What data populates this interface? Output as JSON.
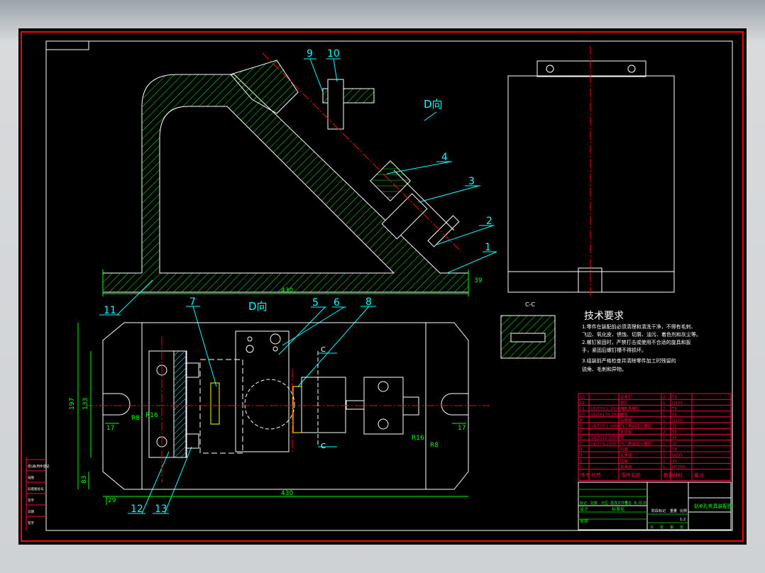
{
  "drawing": {
    "view_labels": {
      "side": "D向",
      "top": "D向",
      "section": "C-C",
      "section_arrow_top": "C",
      "section_arrow_bottom": "C"
    },
    "balloons": [
      "1",
      "2",
      "3",
      "4",
      "5",
      "6",
      "7",
      "8",
      "9",
      "10",
      "11",
      "12",
      "13"
    ],
    "dimensions": {
      "side_length": "430",
      "side_height": "39",
      "top_length": "430",
      "top_width": "197",
      "top_inner": "133",
      "slot_offset_left": "17",
      "slot_offset_right": "17",
      "radius_small": "R8",
      "radius_large": "R16",
      "radius_small_right": "R8",
      "radius_large_right": "R16",
      "corner_h": "83",
      "corner_w": "29"
    },
    "tech_requirements": {
      "title": "技术要求",
      "lines": [
        "1.零件在装配前必须清理和清洗干净，不得有毛刺、",
        "飞边、氧化皮、锈蚀、切屑、油污、着色剂和灰尘等。",
        "2.螺钉紧固时，严禁打击或使用不合适的旋具和扳",
        "手，紧固后螺钉槽不得损坏。",
        "3.组装前严格检查并清除零件加工时残留的",
        "锐角、毛刺和异物。"
      ]
    },
    "parts_list": {
      "header": [
        "序号",
        "代号",
        "零件名称",
        "数量",
        "材料",
        "备注"
      ],
      "rows": [
        [
          "13",
          "",
          "支承钉",
          "2",
          "T8",
          ""
        ],
        [
          "12",
          "",
          "销钉",
          "1",
          "Q235",
          ""
        ],
        [
          "11",
          "GB/T70.1-2000 M8",
          "内六角螺钉",
          "2",
          "T8",
          ""
        ],
        [
          "10",
          "GB/T6170-2000",
          "螺母",
          "1",
          "T8",
          ""
        ],
        [
          "9",
          "",
          "钻模板",
          "1",
          "Q235",
          ""
        ],
        [
          "8",
          "GB/T70.1-2000",
          "内六角圆柱头螺钉",
          "2",
          "35",
          ""
        ],
        [
          "7",
          "",
          "支撑板",
          "2",
          "T8",
          ""
        ],
        [
          "6",
          "GB/T119-2000",
          "销",
          "1",
          "45",
          ""
        ],
        [
          "5",
          "GB/T70-2000",
          "内六角圆柱头螺钉",
          "1",
          "35",
          ""
        ],
        [
          "4",
          "",
          "衬套",
          "1",
          "T8",
          ""
        ],
        [
          "3",
          "",
          "支承座",
          "1",
          "Q235",
          ""
        ],
        [
          "2",
          "",
          "压板",
          "1",
          "45",
          ""
        ],
        [
          "1",
          "",
          "夹具体",
          "1",
          "HT200",
          ""
        ]
      ]
    },
    "title_block": {
      "title": "钻Φ孔夹具装配图",
      "row_labels": [
        "标记",
        "处数",
        "分区",
        "更改文件号",
        "签名",
        "年.月.日"
      ],
      "design": "设计",
      "standard": "标准化",
      "check": "审核",
      "stage": "阶段标记",
      "weight": "重量",
      "scale": "比例",
      "scale_value": "1:2",
      "sheets": [
        "共",
        "张",
        "第",
        "张"
      ]
    },
    "side_strip": [
      "借(通)用件登记",
      "描图",
      "旧底图总号",
      "签字",
      "日期",
      "签字"
    ],
    "colors": {
      "outline": "#ffffff",
      "hatch": "#00ff00",
      "center": "#ff0000",
      "leader": "#00ffff",
      "table": "#ff0040",
      "frame": "#ff0000"
    }
  }
}
